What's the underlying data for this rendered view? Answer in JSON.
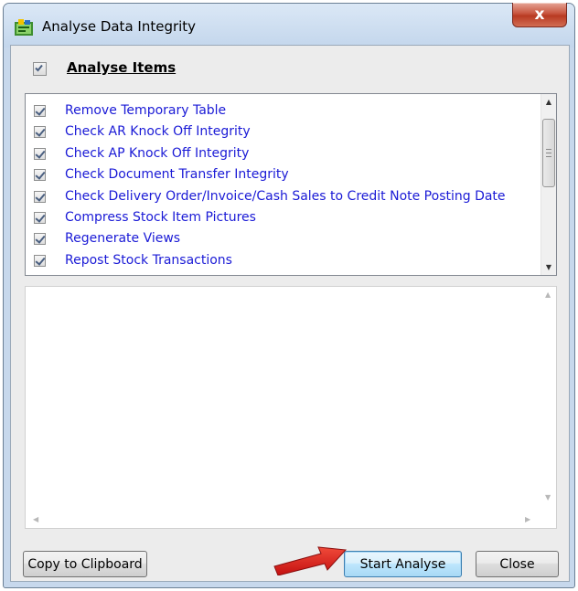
{
  "window": {
    "title": "Analyse Data Integrity",
    "close_glyph": "x"
  },
  "header": {
    "checked": true,
    "label": "Analyse Items"
  },
  "items": [
    {
      "label": "Remove Temporary Table",
      "checked": true
    },
    {
      "label": "Check AR Knock Off Integrity",
      "checked": true
    },
    {
      "label": "Check AP Knock Off Integrity",
      "checked": true
    },
    {
      "label": "Check Document Transfer Integrity",
      "checked": true
    },
    {
      "label": "Check Delivery Order/Invoice/Cash Sales to Credit Note Posting Date",
      "checked": true
    },
    {
      "label": "Compress Stock Item Pictures",
      "checked": true
    },
    {
      "label": "Regenerate Views",
      "checked": true
    },
    {
      "label": "Repost Stock Transactions",
      "checked": true
    }
  ],
  "buttons": {
    "copy": "Copy to Clipboard",
    "start": "Start Analyse",
    "close": "Close"
  },
  "colors": {
    "item_text": "#1a1ad6",
    "annotation_arrow": "#e02020"
  }
}
